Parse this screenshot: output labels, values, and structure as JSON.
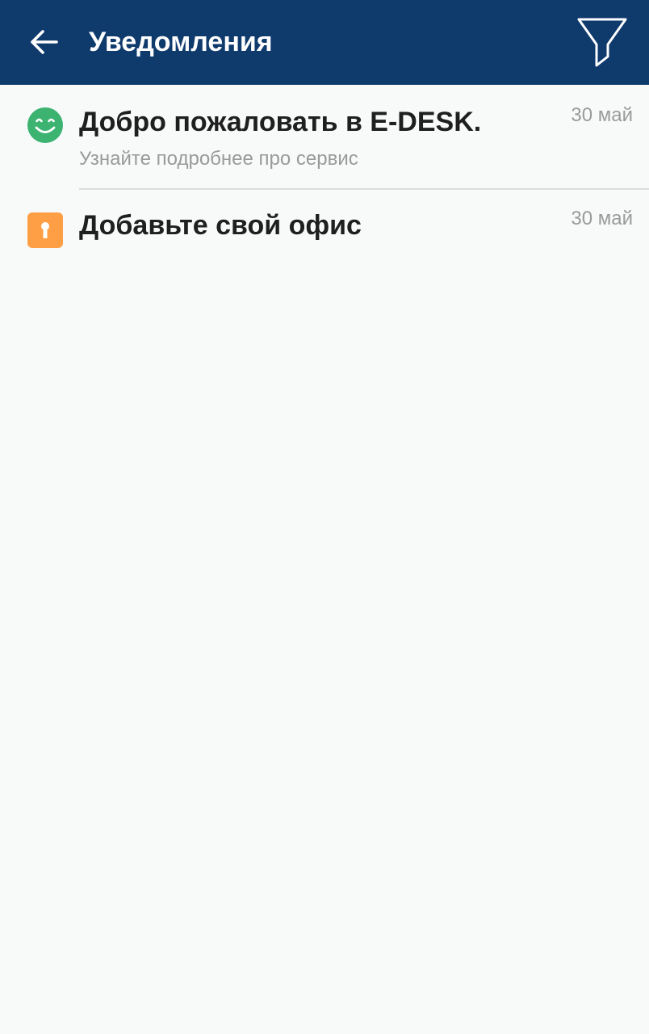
{
  "header": {
    "title": "Уведомления",
    "back_icon": "arrow-left-icon",
    "filter_icon": "filter-icon",
    "background": "#0f3a6c"
  },
  "notifications": [
    {
      "icon": "smiley-icon",
      "icon_color": "#3cb371",
      "title": "Добро пожаловать в E-DESK.",
      "subtitle": "Узнайте подробнее про сервис",
      "date": "30 май"
    },
    {
      "icon": "keyhole-icon",
      "icon_color": "#ff9f45",
      "title": "Добавьте свой офис",
      "subtitle": "",
      "date": "30 май"
    }
  ]
}
